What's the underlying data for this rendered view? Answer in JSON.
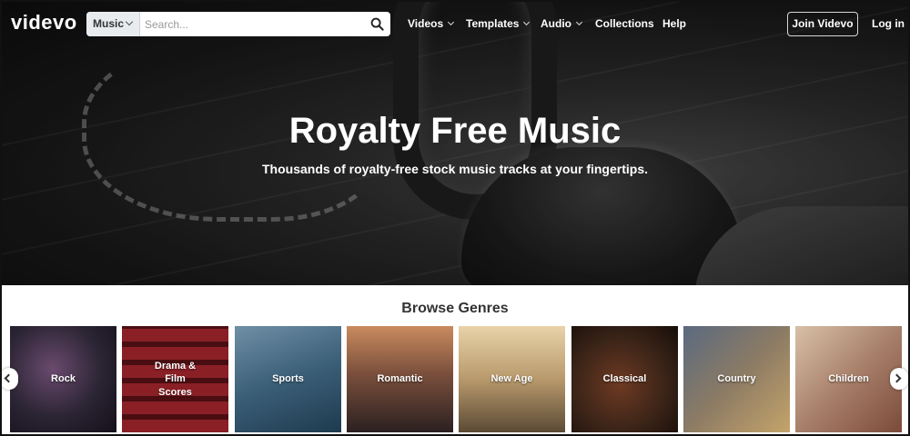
{
  "nav": {
    "logo": "videvo",
    "search_category": "Music",
    "search_placeholder": "Search...",
    "menu": [
      {
        "label": "Videos",
        "has_dropdown": true
      },
      {
        "label": "Templates",
        "has_dropdown": true
      },
      {
        "label": "Audio",
        "has_dropdown": true
      },
      {
        "label": "Collections",
        "has_dropdown": false
      },
      {
        "label": "Help",
        "has_dropdown": false
      }
    ],
    "join_label": "Join Videvo",
    "login_label": "Log in"
  },
  "hero": {
    "title": "Royalty Free Music",
    "subtitle": "Thousands of royalty-free stock music tracks at your fingertips."
  },
  "genres": {
    "title": "Browse Genres",
    "items": [
      {
        "label": "Rock",
        "bg": "#2a2433"
      },
      {
        "label": "Drama & Film Scores",
        "bg": "#6e1a1f"
      },
      {
        "label": "Sports",
        "bg": "#3b5f78"
      },
      {
        "label": "Romantic",
        "bg": "#6b4a3a"
      },
      {
        "label": "New Age",
        "bg": "#a88b62"
      },
      {
        "label": "Classical",
        "bg": "#3b2418"
      },
      {
        "label": "Country",
        "bg": "#7a6a5a"
      },
      {
        "label": "Children",
        "bg": "#9c7d6a"
      }
    ]
  },
  "icons": {
    "search": "search-icon",
    "prev": "chevron-left-icon",
    "next": "chevron-right-icon"
  }
}
